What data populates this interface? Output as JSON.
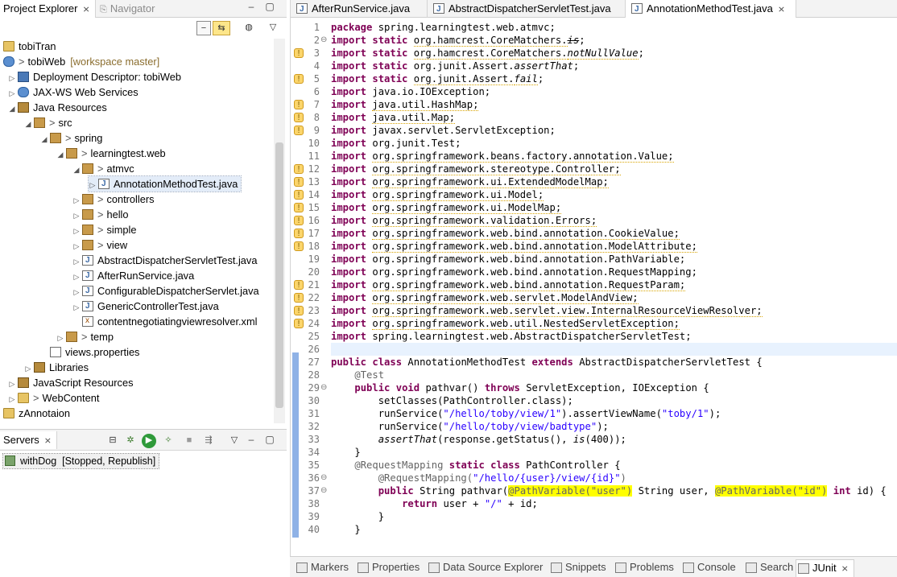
{
  "left_panel": {
    "tabs": {
      "project_explorer": "Project Explorer",
      "navigator": "Navigator"
    },
    "tree": [
      {
        "label": "tobiTran",
        "icon": "folder-closed-icon"
      },
      {
        "label": "tobiWeb",
        "prefix": ">",
        "suffix": "[workspace master]",
        "icon": "web-project-icon"
      },
      {
        "label": "Deployment Descriptor: tobiWeb",
        "icon": "deployment-descriptor-icon"
      },
      {
        "label": "JAX-WS Web Services",
        "icon": "web-services-icon"
      },
      {
        "label": "Java Resources",
        "icon": "java-resources-icon"
      },
      {
        "label": "src",
        "prefix": ">",
        "icon": "source-folder-icon"
      },
      {
        "label": "spring",
        "prefix": ">",
        "icon": "package-icon"
      },
      {
        "label": "learningtest.web",
        "prefix": ">",
        "icon": "package-icon"
      },
      {
        "label": "atmvc",
        "prefix": ">",
        "icon": "package-icon"
      },
      {
        "label": "AnnotationMethodTest.java",
        "icon": "java-file-icon",
        "selected": true
      },
      {
        "label": "controllers",
        "prefix": ">",
        "icon": "package-icon"
      },
      {
        "label": "hello",
        "prefix": ">",
        "icon": "package-icon"
      },
      {
        "label": "simple",
        "prefix": ">",
        "icon": "package-icon"
      },
      {
        "label": "view",
        "prefix": ">",
        "icon": "package-icon"
      },
      {
        "label": "AbstractDispatcherServletTest.java",
        "icon": "java-file-icon"
      },
      {
        "label": "AfterRunService.java",
        "icon": "java-file-icon"
      },
      {
        "label": "ConfigurableDispatcherServlet.java",
        "icon": "java-file-icon"
      },
      {
        "label": "GenericControllerTest.java",
        "icon": "java-file-icon"
      },
      {
        "label": "contentnegotiatingviewresolver.xml",
        "icon": "xml-file-icon"
      },
      {
        "label": "temp",
        "prefix": ">",
        "icon": "package-icon"
      },
      {
        "label": "views.properties",
        "icon": "properties-file-icon"
      },
      {
        "label": "Libraries",
        "icon": "libraries-icon"
      },
      {
        "label": "JavaScript Resources",
        "icon": "javascript-resources-icon"
      },
      {
        "label": "WebContent",
        "prefix": ">",
        "icon": "folder-icon"
      },
      {
        "label": "zAnnotaion",
        "icon": "folder-closed-icon"
      }
    ]
  },
  "servers_panel": {
    "tab_label": "Servers",
    "server": {
      "name": "withDog",
      "status": "[Stopped, Republish]"
    }
  },
  "editor": {
    "tabs": [
      "AfterRunService.java",
      "AbstractDispatcherServletTest.java",
      "AnnotationMethodTest.java"
    ],
    "line_numbers": [
      "1",
      "2",
      "3",
      "4",
      "5",
      "6",
      "7",
      "8",
      "9",
      "10",
      "11",
      "12",
      "13",
      "14",
      "15",
      "16",
      "17",
      "18",
      "19",
      "20",
      "21",
      "22",
      "23",
      "24",
      "25",
      "26",
      "27",
      "28",
      "29",
      "30",
      "31",
      "32",
      "33",
      "34",
      "35",
      "36",
      "37",
      "38",
      "39",
      "40"
    ],
    "code": {
      "l1": "spring.learningtest.web.atmvc;",
      "l2": "org.hamcrest.CoreMatchers.",
      "l2b": "is",
      "l3": "org.hamcrest.CoreMatchers.",
      "l3b": "notNullValue",
      "l4": "org.junit.Assert.",
      "l4b": "assertThat",
      "l5": "org.junit.Assert.",
      "l5b": "fail",
      "l6": "java.io.IOException;",
      "l7": "java.util.HashMap;",
      "l8": "java.util.Map;",
      "l9": "javax.servlet.ServletException;",
      "l10": "org.junit.Test;",
      "l11": "org.springframework.beans.factory.annotation.Value;",
      "l12": "org.springframework.stereotype.Controller;",
      "l13": "org.springframework.ui.ExtendedModelMap;",
      "l14": "org.springframework.ui.Model;",
      "l15": "org.springframework.ui.ModelMap;",
      "l16": "org.springframework.validation.Errors;",
      "l17": "org.springframework.web.bind.annotation.CookieValue;",
      "l18": "org.springframework.web.bind.annotation.ModelAttribute;",
      "l19": "org.springframework.web.bind.annotation.PathVariable;",
      "l20": "org.springframework.web.bind.annotation.RequestMapping;",
      "l21": "org.springframework.web.bind.annotation.RequestParam;",
      "l22": "org.springframework.web.servlet.ModelAndView;",
      "l23": "org.springframework.web.servlet.view.InternalResourceViewResolver;",
      "l24": "org.springframework.web.util.NestedServletException;",
      "l25": "spring.learningtest.web.AbstractDispatcherServletTest;",
      "l27a": "AnnotationMethodTest",
      "l27b": "AbstractDispatcherServletTest {",
      "l28": "@Test",
      "l29a": "pathvar()",
      "l29b": "ServletException, IOException {",
      "l30": "setClasses(PathController.class);",
      "l31a": "runService(",
      "l31s": "\"/hello/toby/view/1\"",
      "l31b": ").assertViewName(",
      "l31s2": "\"toby/1\"",
      "l31c": ");",
      "l32a": "runService(",
      "l32s": "\"/hello/toby/view/badtype\"",
      "l32b": ");",
      "l33a": "assertThat",
      "l33b": "(response.getStatus(), ",
      "l33c": "is",
      "l33d": "(400));",
      "l34": "}",
      "l35a": "@RequestMapping",
      "l35b": "PathController {",
      "l36a": "@RequestMapping(",
      "l36s": "\"/hello/{user}/view/{id}\"",
      "l36b": ")",
      "l37a": "String pathvar(",
      "l37h1": "@PathVariable(\"user\")",
      "l37b": " String user, ",
      "l37h2": "@PathVariable(\"id\")",
      "l37c": " ",
      "l37d": " id) {",
      "l38a": "user + ",
      "l38s": "\"/\"",
      "l38b": " + id;",
      "l39": "}",
      "l40": "}"
    },
    "keywords": {
      "package": "package",
      "import": "import",
      "static": "static",
      "public": "public",
      "class": "class",
      "extends": "extends",
      "void": "void",
      "throws": "throws",
      "return": "return",
      "int": "int"
    }
  },
  "bottom_tabs": [
    "Markers",
    "Properties",
    "Data Source Explorer",
    "Snippets",
    "Problems",
    "Console",
    "Search",
    "JUnit"
  ]
}
